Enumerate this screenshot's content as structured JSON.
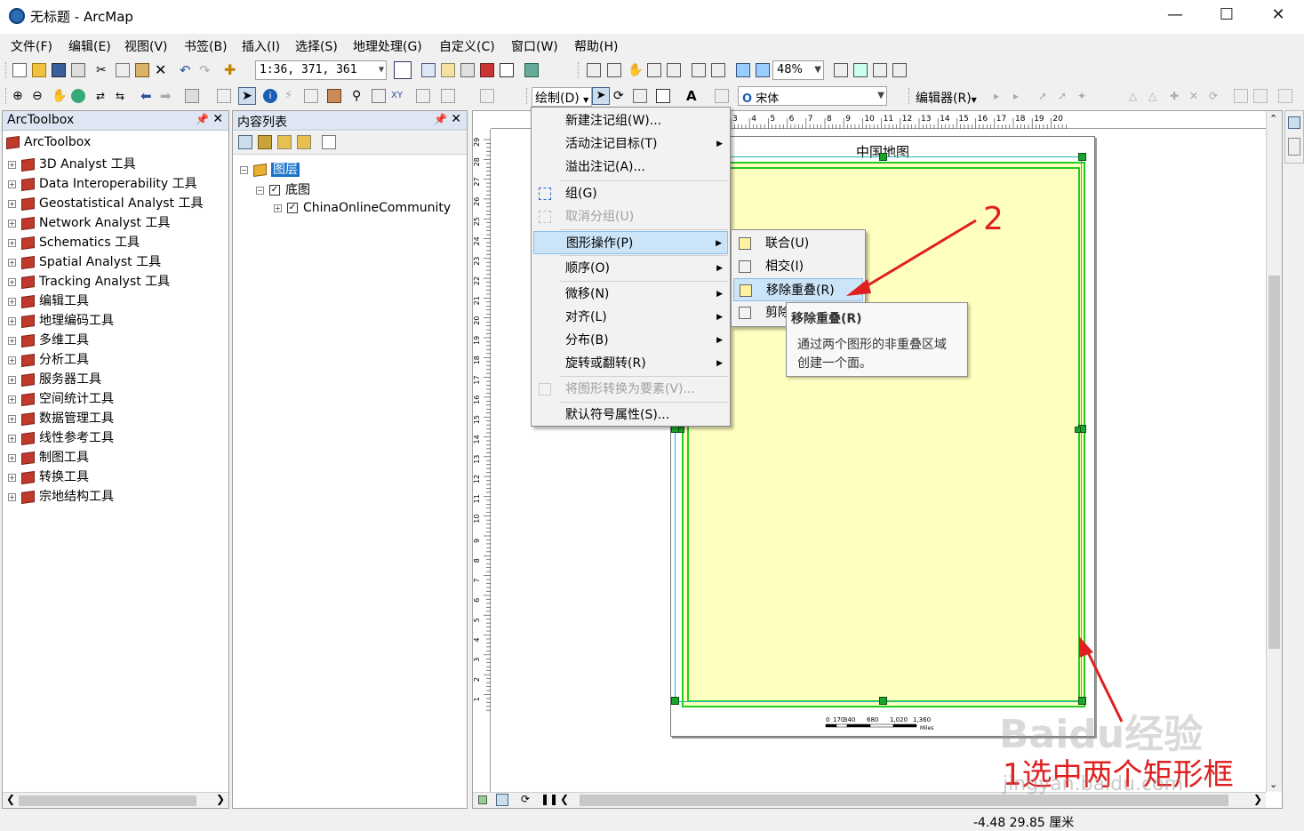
{
  "window": {
    "title": "无标题 - ArcMap"
  },
  "menubar": [
    "文件(F)",
    "编辑(E)",
    "视图(V)",
    "书签(B)",
    "插入(I)",
    "选择(S)",
    "地理处理(G)",
    "自定义(C)",
    "窗口(W)",
    "帮助(H)"
  ],
  "toolbar": {
    "scale_value": "1:36, 371, 361",
    "zoom_value": "48%",
    "draw_label": "绘制(D)",
    "font_value": "宋体",
    "editor_label": "编辑器(R)"
  },
  "toolbox": {
    "title": "ArcToolbox",
    "root": "ArcToolbox",
    "items": [
      "3D Analyst 工具",
      "Data Interoperability 工具",
      "Geostatistical Analyst 工具",
      "Network Analyst 工具",
      "Schematics 工具",
      "Spatial Analyst 工具",
      "Tracking Analyst 工具",
      "编辑工具",
      "地理编码工具",
      "多维工具",
      "分析工具",
      "服务器工具",
      "空间统计工具",
      "数据管理工具",
      "线性参考工具",
      "制图工具",
      "转换工具",
      "宗地结构工具"
    ]
  },
  "toc": {
    "title": "内容列表",
    "layers_label": "图层",
    "group_label": "底图",
    "layer_label": "ChinaOnlineCommunity"
  },
  "layout": {
    "map_title": "中国地图",
    "hruler_labels": [
      "3",
      "4",
      "5",
      "6",
      "7",
      "8",
      "9",
      "10",
      "11",
      "12",
      "13",
      "14",
      "15",
      "16",
      "17",
      "18",
      "19",
      "20"
    ],
    "vruler_labels": [
      "29",
      "28",
      "27",
      "26",
      "25",
      "24",
      "23",
      "22",
      "21",
      "20",
      "19",
      "18",
      "17",
      "16",
      "15",
      "14",
      "13",
      "12",
      "11",
      "10",
      "9",
      "8",
      "7",
      "6",
      "5",
      "4",
      "3",
      "2",
      "1"
    ],
    "scalebar_labels": [
      "0",
      "170",
      "340",
      "680",
      "1,020",
      "1,360"
    ],
    "scalebar_unit": "Miles"
  },
  "draw_menu": {
    "items": [
      "新建注记组(W)...",
      "活动注记目标(T)",
      "溢出注记(A)...",
      "组(G)",
      "取消分组(U)",
      "图形操作(P)",
      "顺序(O)",
      "微移(N)",
      "对齐(L)",
      "分布(B)",
      "旋转或翻转(R)",
      "将图形转换为要素(V)...",
      "默认符号属性(S)..."
    ]
  },
  "graphic_ops_menu": {
    "items": [
      "联合(U)",
      "相交(I)",
      "移除重叠(R)",
      "剪除"
    ]
  },
  "tooltip": {
    "title": "移除重叠(R)",
    "line1": "通过两个图形的非重叠区域",
    "line2": "创建一个面。"
  },
  "annotations": {
    "step2": "2",
    "step1": "1选中两个矩形框",
    "watermark": "Baidu经验",
    "watermark_url": "jingyan.baidu.com"
  },
  "status": {
    "coords": "-4.48  29.85 厘米"
  },
  "colors": {
    "map_fill": "#ffffc0",
    "selection": "#22cc22",
    "annotation_red": "#e02020"
  }
}
